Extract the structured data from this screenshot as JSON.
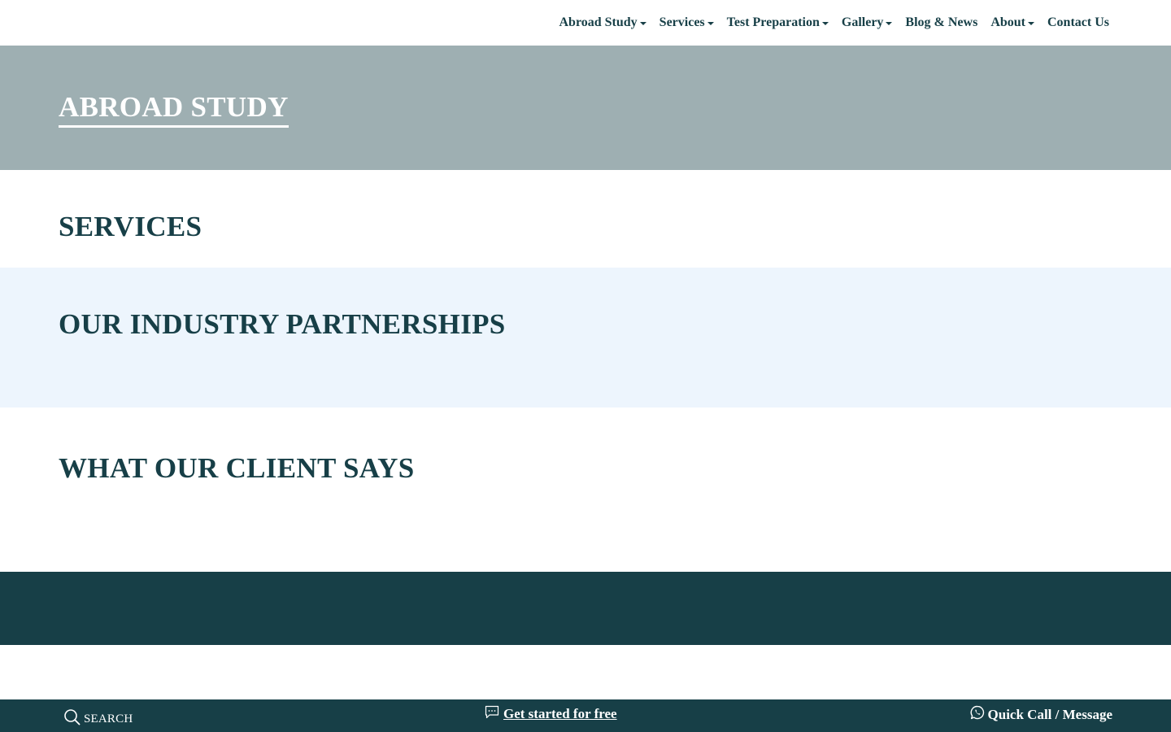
{
  "nav": {
    "items": [
      {
        "label": "Abroad Study",
        "dropdown": true
      },
      {
        "label": "Services",
        "dropdown": true
      },
      {
        "label": "Test Preparation",
        "dropdown": true
      },
      {
        "label": "Gallery",
        "dropdown": true
      },
      {
        "label": "Blog & News",
        "dropdown": false
      },
      {
        "label": "About",
        "dropdown": true
      },
      {
        "label": "Contact Us",
        "dropdown": false
      }
    ]
  },
  "hero": {
    "title": "ABROAD STUDY"
  },
  "sections": {
    "services": "SERVICES",
    "partnerships": "OUR INDUSTRY PARTNERSHIPS",
    "testimonials": "WHAT OUR CLIENT SAYS"
  },
  "bottom_bar": {
    "search_label": "SEARCH",
    "cta_label": "Get started for free",
    "quick_label": "Quick Call / Message"
  },
  "colors": {
    "primary": "#173f47",
    "hero_bg": "#9eafb2",
    "partners_bg": "#edf5fd",
    "white": "#ffffff"
  },
  "icons": {
    "search": "search-icon",
    "chat": "chat-icon",
    "whatsapp": "whatsapp-icon",
    "caret": "chevron-down-icon"
  }
}
